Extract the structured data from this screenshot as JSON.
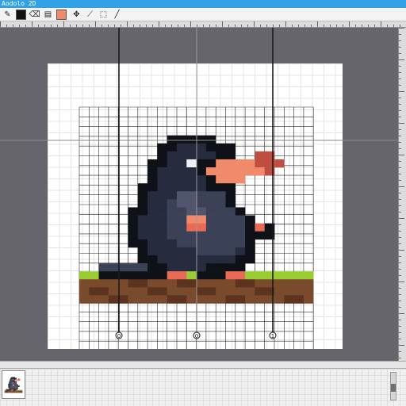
{
  "app": {
    "title": "Aodolo 2D"
  },
  "toolbar": {
    "tools": [
      {
        "name": "pencil-icon",
        "glyph": "✎"
      },
      {
        "name": "eraser-icon",
        "glyph": "⌫"
      },
      {
        "name": "fill-icon",
        "glyph": "▤"
      },
      {
        "name": "move-icon",
        "glyph": "✥"
      },
      {
        "name": "eyedropper-icon",
        "glyph": "⟋"
      },
      {
        "name": "select-icon",
        "glyph": "⬚"
      }
    ],
    "primary_color": "#111111",
    "secondary_color": "#f08a6a"
  },
  "guides": {
    "markers": [
      "0",
      "0",
      "1"
    ]
  },
  "sprite": {
    "palette": {
      "B": "#0e1118",
      "D": "#262c3d",
      "M": "#3b4258",
      "G": "#4f566d",
      "P": "#f08a6a",
      "R": "#c04e40",
      "E": "#eef2f6",
      "L": "#9acd32",
      "S": "#7a4a2c",
      "T": "#5c331e",
      "W": "#e96a55"
    },
    "rows": [
      "........................",
      "........................",
      "........................",
      "........................",
      "........................",
      "........................",
      "........................",
      "........................",
      ".........BBBBB..........",
      "........BBDDDBBB........",
      "........BDDDDDBB..RR....",
      ".......BBDDEBBPPPPRRR...",
      ".......BDDDDBPPPPPPR....",
      ".......BDDDDDBPPP.......",
      "......BBDDDDDBBB........",
      "......BDDDGGMMMB........",
      "......BDDMGGMMMB........",
      ".....BBDDMMGGMMMB.......",
      ".....BDDDMMPPMMMMB......",
      ".....BDDDMMWWMMMMBWB....",
      ".....BDDDMMMMMMMMBBB....",
      ".....BBDDDMMMMMMMB......",
      "......BDDDDDMMMMDB......",
      "......BBDDDDDDDDBB......",
      "..MMMMMBBDDDDBBBB.......",
      "LLBBBBBBBWWLBBBWWLLLLLLL",
      "SSSSSTTSSSTTSSSSTTSSSSSS",
      "STTSSSSTTSSSTTSSSSTTSSSS",
      "SSSTTSSSSTTSSSSTTSSSSTTS",
      "........................",
      "........................",
      "........................",
      "........................",
      "........................",
      "........................",
      "........................"
    ]
  }
}
